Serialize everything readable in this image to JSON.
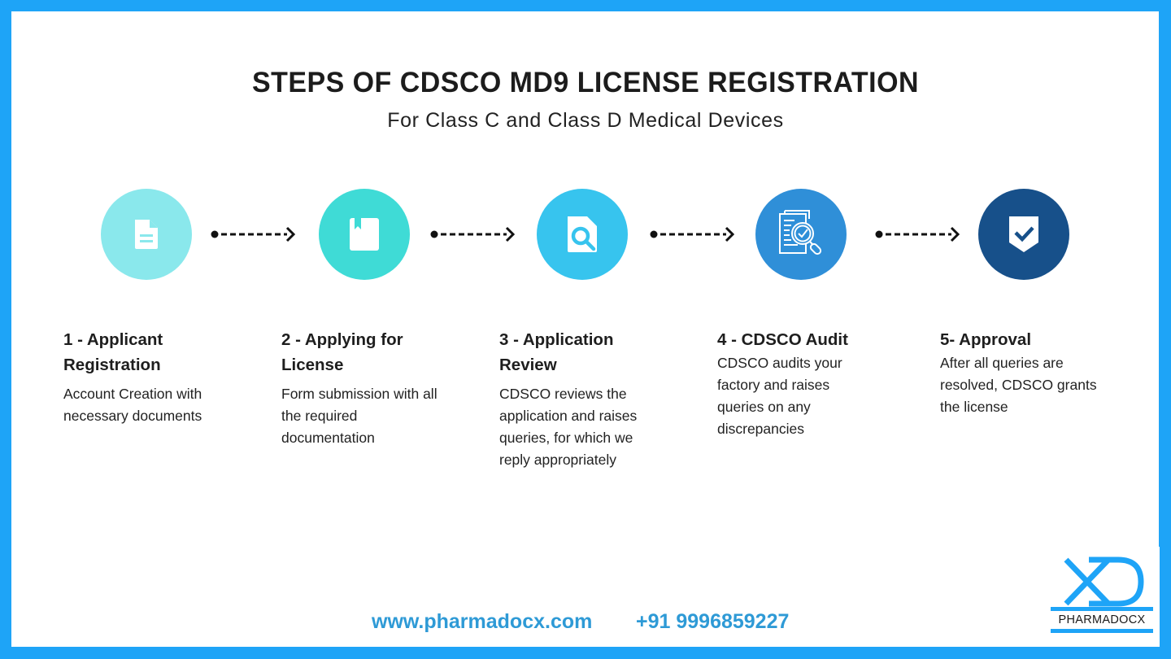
{
  "header": {
    "title": "STEPS OF CDSCO MD9 LICENSE REGISTRATION",
    "subtitle": "For Class C and Class D Medical Devices"
  },
  "colors": {
    "border": "#1ea4f7",
    "step1": "#8ae8ec",
    "step2": "#3fdbd6",
    "step3": "#37c4ee",
    "step4": "#2f8fd8",
    "step5": "#17508a",
    "footer_text": "#2e9ad6"
  },
  "steps": [
    {
      "icon": "document-icon",
      "title": "1 - Applicant Registration",
      "description": "Account Creation with necessary documents"
    },
    {
      "icon": "bookmark-book-icon",
      "title": "2 - Applying for License",
      "description": "Form submission with all the required documentation"
    },
    {
      "icon": "document-search-icon",
      "title": "3 - Application Review",
      "description": "CDSCO reviews the application and raises queries, for which we reply appropriately"
    },
    {
      "icon": "audit-magnifier-check-icon",
      "title": "4 - CDSCO Audit",
      "description": "CDSCO audits your factory and raises queries on any discrepancies"
    },
    {
      "icon": "shield-check-icon",
      "title": "5- Approval",
      "description": "After all queries are resolved, CDSCO grants the license"
    }
  ],
  "connectors": [
    "dotted-arrow-icon",
    "dotted-arrow-icon",
    "dotted-arrow-icon",
    "dotted-arrow-icon"
  ],
  "footer": {
    "website": "www.pharmadocx.com",
    "phone": "+91 9996859227"
  },
  "logo": {
    "mark": "XD",
    "name": "PHARMADOCX"
  }
}
